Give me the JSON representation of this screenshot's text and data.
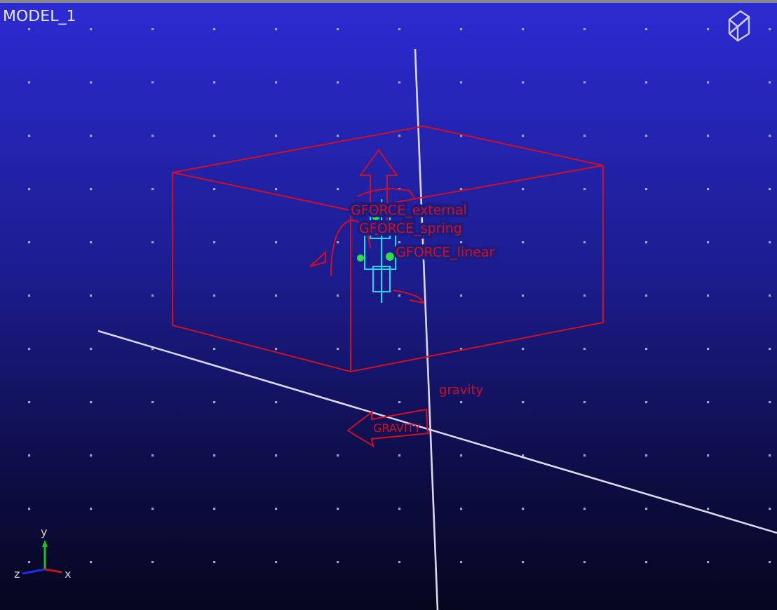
{
  "viewport": {
    "title": "MODEL_1"
  },
  "force_labels": [
    "GFORCE_external",
    "GFORCE_spring",
    "GFORCE_linear"
  ],
  "gravity": {
    "label": "gravity",
    "arrow_text": "GRAVITY"
  },
  "triad": {
    "y": "y",
    "z": "z",
    "x": "x"
  }
}
